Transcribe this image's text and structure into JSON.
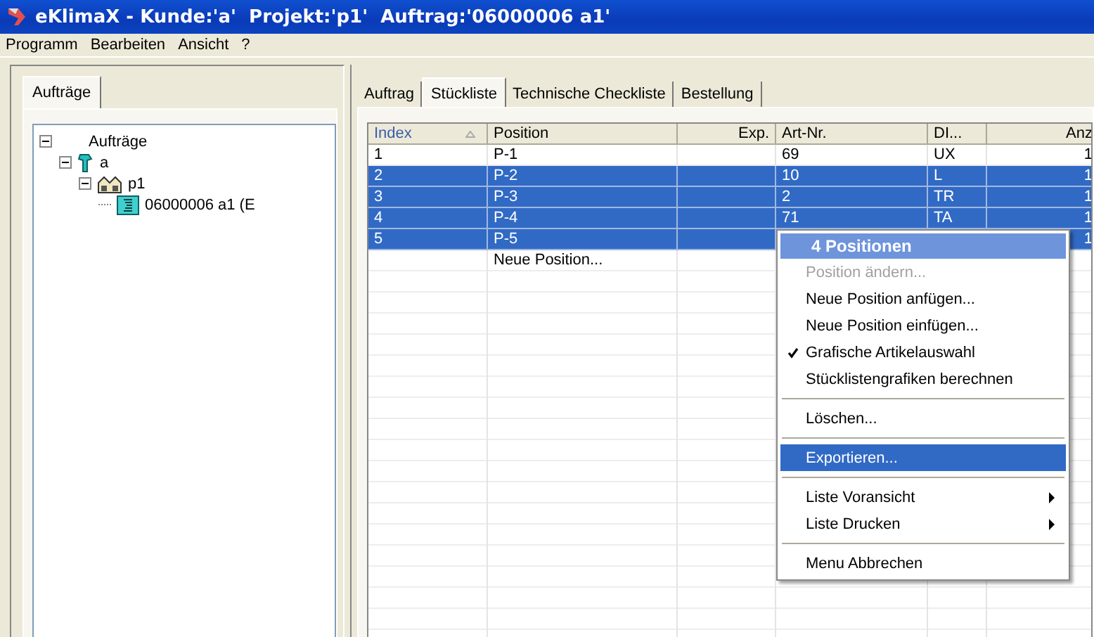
{
  "window": {
    "title": "eKlimaX - Kunde:'a'  Projekt:'p1'  Auftrag:'06000006 a1'"
  },
  "menu_bar": [
    "Programm",
    "Bearbeiten",
    "Ansicht",
    "?"
  ],
  "left_tabs": [
    {
      "label": "Aufträge",
      "selected": true
    }
  ],
  "tree": [
    {
      "label": "Aufträge",
      "expanded": true,
      "children": [
        {
          "label": "a",
          "expanded": true,
          "children": [
            {
              "label": "p1",
              "expanded": true,
              "children": [
                {
                  "label": "06000006 a1 (E"
                }
              ]
            }
          ]
        }
      ]
    }
  ],
  "tabs": [
    {
      "label": "Auftrag",
      "selected": false
    },
    {
      "label": "Stückliste",
      "selected": true
    },
    {
      "label": "Technische Checkliste",
      "selected": false
    },
    {
      "label": "Bestellung",
      "selected": false
    }
  ],
  "table": {
    "columns": [
      {
        "label": "Index",
        "sorted": true
      },
      {
        "label": "Position",
        "sorted": false
      },
      {
        "label": "Exp.",
        "sorted": false
      },
      {
        "label": "Art-Nr.",
        "sorted": false
      },
      {
        "label": "DI...",
        "sorted": false
      },
      {
        "label": "Anz",
        "sorted": false
      }
    ],
    "rows": [
      {
        "cells": [
          "1",
          "P-1",
          "",
          "69",
          "UX",
          "1"
        ],
        "selected": false
      },
      {
        "cells": [
          "2",
          "P-2",
          "",
          "10",
          "L",
          "1"
        ],
        "selected": true
      },
      {
        "cells": [
          "3",
          "P-3",
          "",
          "2",
          "TR",
          "1"
        ],
        "selected": true
      },
      {
        "cells": [
          "4",
          "P-4",
          "",
          "71",
          "TA",
          "1"
        ],
        "selected": true
      },
      {
        "cells": [
          "5",
          "P-5",
          "",
          "",
          "",
          "1"
        ],
        "selected": true
      },
      {
        "cells": [
          "",
          "Neue Position...",
          "",
          "",
          "",
          ""
        ],
        "selected": false
      }
    ]
  },
  "context_menu": [
    {
      "kind": "header",
      "label": "4 Positionen"
    },
    {
      "kind": "item",
      "label": "Position ändern...",
      "disabled": true,
      "checked": false,
      "submenu": false,
      "selected": false
    },
    {
      "kind": "item",
      "label": "Neue Position anfügen...",
      "disabled": false,
      "checked": false,
      "submenu": false,
      "selected": false
    },
    {
      "kind": "item",
      "label": "Neue Position einfügen...",
      "disabled": false,
      "checked": false,
      "submenu": false,
      "selected": false
    },
    {
      "kind": "item",
      "label": "Grafische Artikelauswahl",
      "disabled": false,
      "checked": true,
      "submenu": false,
      "selected": false
    },
    {
      "kind": "item",
      "label": "Stücklistengrafiken berechnen",
      "disabled": false,
      "checked": false,
      "submenu": false,
      "selected": false
    },
    {
      "kind": "separator"
    },
    {
      "kind": "item",
      "label": "Löschen...",
      "disabled": false,
      "checked": false,
      "submenu": false,
      "selected": false
    },
    {
      "kind": "separator"
    },
    {
      "kind": "item",
      "label": "Exportieren...",
      "disabled": false,
      "checked": false,
      "submenu": false,
      "selected": true
    },
    {
      "kind": "separator"
    },
    {
      "kind": "item",
      "label": "Liste Voransicht",
      "disabled": false,
      "checked": false,
      "submenu": true,
      "selected": false
    },
    {
      "kind": "item",
      "label": "Liste Drucken",
      "disabled": false,
      "checked": false,
      "submenu": true,
      "selected": false
    },
    {
      "kind": "separator"
    },
    {
      "kind": "item",
      "label": "Menu Abbrechen",
      "disabled": false,
      "checked": false,
      "submenu": false,
      "selected": false
    }
  ]
}
